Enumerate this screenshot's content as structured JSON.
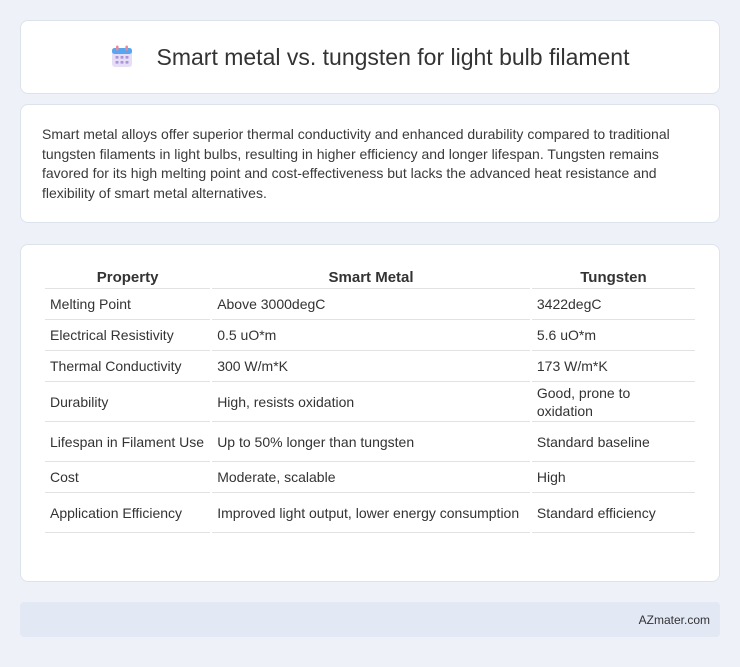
{
  "header": {
    "title": "Smart metal vs. tungsten for light bulb filament",
    "icon": "calendar-icon"
  },
  "summary": {
    "text": "Smart metal alloys offer superior thermal conductivity and enhanced durability compared to traditional tungsten filaments in light bulbs, resulting in higher efficiency and longer lifespan. Tungsten remains favored for its high melting point and cost-effectiveness but lacks the advanced heat resistance and flexibility of smart metal alternatives."
  },
  "table": {
    "headers": [
      "Property",
      "Smart Metal",
      "Tungsten"
    ],
    "rows": [
      [
        "Melting Point",
        "Above 3000degC",
        "3422degC"
      ],
      [
        "Electrical Resistivity",
        "0.5 uO*m",
        "5.6 uO*m"
      ],
      [
        "Thermal Conductivity",
        "300 W/m*K",
        "173 W/m*K"
      ],
      [
        "Durability",
        "High, resists oxidation",
        "Good, prone to oxidation"
      ],
      [
        "Lifespan in Filament Use",
        "Up to 50% longer than tungsten",
        "Standard baseline"
      ],
      [
        "Cost",
        "Moderate, scalable",
        "High"
      ],
      [
        "Application Efficiency",
        "Improved light output, lower energy consumption",
        "Standard efficiency"
      ]
    ]
  },
  "footer": {
    "text": "AZmater.com"
  },
  "colors": {
    "page_background": "#eef2f8",
    "card_background": "#ffffff",
    "footer_background": "#e2e8f4"
  }
}
